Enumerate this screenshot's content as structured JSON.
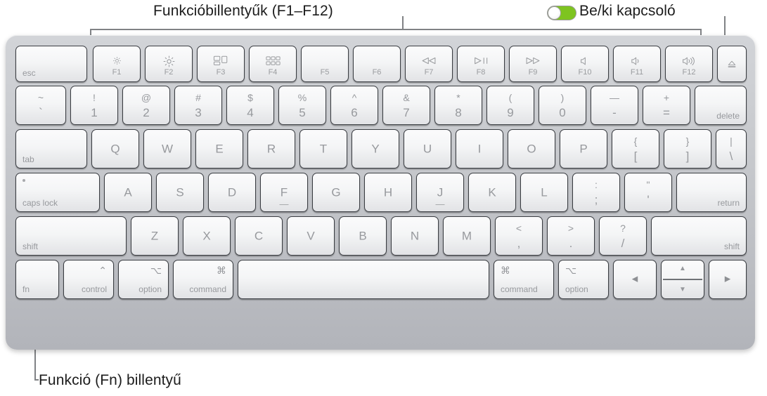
{
  "callouts": {
    "function_keys": "Funkcióbillentyűk (F1–F12)",
    "power_switch": "Be/ki kapcsoló",
    "fn_key": "Funkció (Fn) billentyű"
  },
  "colors": {
    "toggle_on": "#7ec420",
    "toggle_knob": "#ffffff",
    "leader_line": "#808285",
    "key_face": "#f4f5f6",
    "key_border": "#3a3d42",
    "key_legend": "#97999d",
    "chassis": "#c8cace",
    "label_text": "#1c1c1c"
  },
  "keyboard": {
    "rows": [
      {
        "name": "function-row",
        "keys": [
          {
            "id": "esc",
            "label": "esc",
            "pos": "bottom-left"
          },
          {
            "id": "f1",
            "fnum": "F1",
            "icon": "brightness-down-icon"
          },
          {
            "id": "f2",
            "fnum": "F2",
            "icon": "brightness-up-icon"
          },
          {
            "id": "f3",
            "fnum": "F3",
            "icon": "mission-control-icon"
          },
          {
            "id": "f4",
            "fnum": "F4",
            "icon": "launchpad-icon"
          },
          {
            "id": "f5",
            "fnum": "F5",
            "icon": "none"
          },
          {
            "id": "f6",
            "fnum": "F6",
            "icon": "none"
          },
          {
            "id": "f7",
            "fnum": "F7",
            "icon": "rewind-icon"
          },
          {
            "id": "f8",
            "fnum": "F8",
            "icon": "play-pause-icon"
          },
          {
            "id": "f9",
            "fnum": "F9",
            "icon": "fast-forward-icon"
          },
          {
            "id": "f10",
            "fnum": "F10",
            "icon": "mute-icon"
          },
          {
            "id": "f11",
            "fnum": "F11",
            "icon": "volume-down-icon"
          },
          {
            "id": "f12",
            "fnum": "F12",
            "icon": "volume-up-icon"
          },
          {
            "id": "eject",
            "icon": "eject-icon"
          }
        ]
      },
      {
        "name": "number-row",
        "keys": [
          {
            "id": "grave",
            "upper": "~",
            "lower": "`"
          },
          {
            "id": "one",
            "upper": "!",
            "lower": "1"
          },
          {
            "id": "two",
            "upper": "@",
            "lower": "2"
          },
          {
            "id": "three",
            "upper": "#",
            "lower": "3"
          },
          {
            "id": "four",
            "upper": "$",
            "lower": "4"
          },
          {
            "id": "five",
            "upper": "%",
            "lower": "5"
          },
          {
            "id": "six",
            "upper": "^",
            "lower": "6"
          },
          {
            "id": "seven",
            "upper": "&",
            "lower": "7"
          },
          {
            "id": "eight",
            "upper": "*",
            "lower": "8"
          },
          {
            "id": "nine",
            "upper": "(",
            "lower": "9"
          },
          {
            "id": "zero",
            "upper": ")",
            "lower": "0"
          },
          {
            "id": "minus",
            "upper": "—",
            "lower": "-"
          },
          {
            "id": "equal",
            "upper": "+",
            "lower": "="
          },
          {
            "id": "delete",
            "label": "delete",
            "pos": "bottom-right"
          }
        ]
      },
      {
        "name": "qwerty-row",
        "keys": [
          {
            "id": "tab",
            "label": "tab",
            "pos": "bottom-left"
          },
          {
            "id": "q",
            "label": "Q"
          },
          {
            "id": "w",
            "label": "W"
          },
          {
            "id": "e",
            "label": "E"
          },
          {
            "id": "r",
            "label": "R"
          },
          {
            "id": "t",
            "label": "T"
          },
          {
            "id": "y",
            "label": "Y"
          },
          {
            "id": "u",
            "label": "U"
          },
          {
            "id": "i",
            "label": "I"
          },
          {
            "id": "o",
            "label": "O"
          },
          {
            "id": "p",
            "label": "P"
          },
          {
            "id": "bracketleft",
            "upper": "{",
            "lower": "["
          },
          {
            "id": "bracketright",
            "upper": "}",
            "lower": "]"
          },
          {
            "id": "backslash",
            "upper": "|",
            "lower": "\\"
          }
        ]
      },
      {
        "name": "home-row",
        "keys": [
          {
            "id": "capslock",
            "label": "caps lock",
            "pos": "bottom-left",
            "indicator": "caps-lock-dot"
          },
          {
            "id": "a",
            "label": "A"
          },
          {
            "id": "s",
            "label": "S"
          },
          {
            "id": "d",
            "label": "D"
          },
          {
            "id": "f",
            "label": "F",
            "homing": true
          },
          {
            "id": "g",
            "label": "G"
          },
          {
            "id": "h",
            "label": "H"
          },
          {
            "id": "j",
            "label": "J",
            "homing": true
          },
          {
            "id": "k",
            "label": "K"
          },
          {
            "id": "l",
            "label": "L"
          },
          {
            "id": "semicolon",
            "upper": ":",
            "lower": ";"
          },
          {
            "id": "quote",
            "upper": "\"",
            "lower": "'"
          },
          {
            "id": "return",
            "label": "return",
            "pos": "bottom-right"
          }
        ]
      },
      {
        "name": "shift-row",
        "keys": [
          {
            "id": "shift-left",
            "label": "shift",
            "pos": "bottom-left"
          },
          {
            "id": "z",
            "label": "Z"
          },
          {
            "id": "x",
            "label": "X"
          },
          {
            "id": "c",
            "label": "C"
          },
          {
            "id": "v",
            "label": "V"
          },
          {
            "id": "b",
            "label": "B"
          },
          {
            "id": "n",
            "label": "N"
          },
          {
            "id": "m",
            "label": "M"
          },
          {
            "id": "comma",
            "upper": "<",
            "lower": ","
          },
          {
            "id": "period",
            "upper": ">",
            "lower": "."
          },
          {
            "id": "slash",
            "upper": "?",
            "lower": "/"
          },
          {
            "id": "shift-right",
            "label": "shift",
            "pos": "bottom-right"
          }
        ]
      },
      {
        "name": "bottom-row",
        "keys": [
          {
            "id": "fn",
            "label": "fn",
            "pos": "bottom-left"
          },
          {
            "id": "control",
            "label": "control",
            "pos": "bottom-right",
            "symbol": "⌃"
          },
          {
            "id": "option-left",
            "label": "option",
            "pos": "bottom-right",
            "symbol": "⌥"
          },
          {
            "id": "command-left",
            "label": "command",
            "pos": "bottom-right",
            "symbol": "⌘"
          },
          {
            "id": "space",
            "label": ""
          },
          {
            "id": "command-right",
            "label": "command",
            "pos": "bottom-left-sym",
            "symbol": "⌘"
          },
          {
            "id": "option-right",
            "label": "option",
            "pos": "bottom-left-sym",
            "symbol": "⌥"
          },
          {
            "id": "arrow-left",
            "glyph": "◀",
            "icon": "arrow-left-icon"
          },
          {
            "id": "arrow-updown",
            "glyph_up": "▲",
            "glyph_down": "▼",
            "icon": "arrow-up-down-icon"
          },
          {
            "id": "arrow-right",
            "glyph": "▶",
            "icon": "arrow-right-icon"
          }
        ]
      }
    ]
  }
}
